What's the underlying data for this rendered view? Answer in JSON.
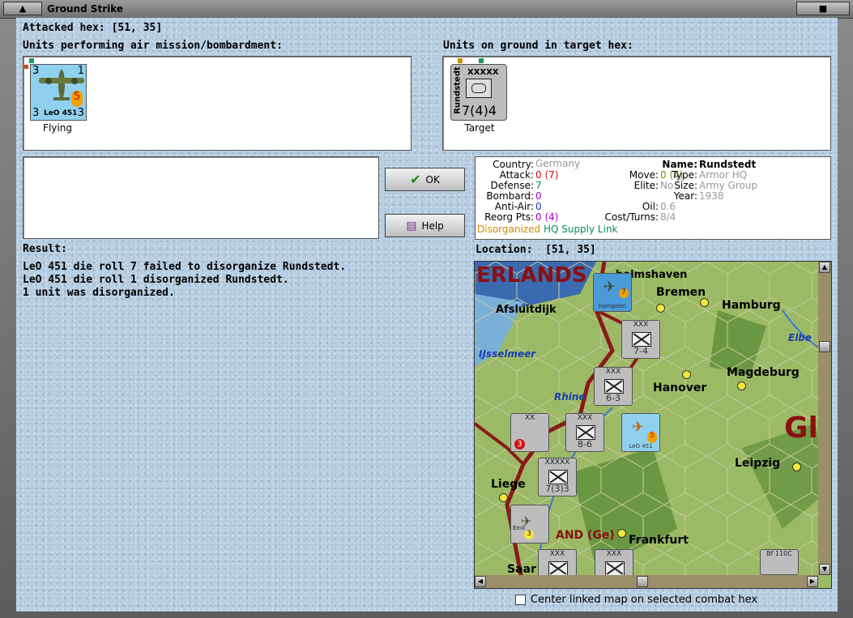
{
  "window": {
    "title": "Ground Strike"
  },
  "attacked_hex": {
    "label": "Attacked hex:",
    "value": "[51, 35]"
  },
  "air_units": {
    "label": "Units performing air mission/bombardment:",
    "unit": {
      "name": "LeO 451",
      "left_num": "3",
      "right_num": "1",
      "bottom_left": "3",
      "bottom_right": "3",
      "badge": "5",
      "caption": "Flying"
    }
  },
  "ground_units": {
    "label": "Units on ground in target hex:",
    "unit": {
      "name": "Rundstedt",
      "size": "XXXXX",
      "strength": "7(4)4",
      "caption": "Target"
    }
  },
  "buttons": {
    "ok": "OK",
    "help": "Help"
  },
  "info": {
    "country_k": "Country:",
    "country_v": "Germany",
    "attack_k": "Attack:",
    "attack_v": "0",
    "attack_v2": "(7)",
    "defense_k": "Defense:",
    "defense_v": "7",
    "bombard_k": "Bombard:",
    "bombard_v": "0",
    "antiair_k": "Anti-Air:",
    "antiair_v": "0",
    "reorg_k": "Reorg Pts:",
    "reorg_v": "0",
    "reorg_v2": "(4)",
    "name_k": "Name:",
    "name_v": "Rundstedt",
    "move_k": "Move:",
    "move_v": "0",
    "move_v2": "(4)",
    "type_k": "Type:",
    "type_v": "Armor HQ",
    "elite_k": "Elite:",
    "elite_v": "No",
    "size_k": "Size:",
    "size_v": "Army Group",
    "year_k": "Year:",
    "year_v": "1938",
    "oil_k": "Oil:",
    "oil_v": "0.6",
    "cost_k": "Cost/Turns:",
    "cost_v": "8/4",
    "status1": "Disorganized",
    "status2": "HQ Supply Link"
  },
  "result": {
    "label": "Result:",
    "lines": [
      "LeO 451 die roll 7 failed to disorganize Rundstedt.",
      "LeO 451 die roll 1 disorganized Rundstedt.",
      "1 unit was disorganized."
    ]
  },
  "location": {
    "label": "Location:",
    "value": "[51, 35]"
  },
  "map": {
    "cities": [
      "Bremen",
      "Hamburg",
      "Magdeburg",
      "Hanover",
      "Leipzig",
      "Liege",
      "Frankfurt",
      "Saar",
      "Afsluitdijk"
    ],
    "region_labels": [
      "ERLANDS",
      "AND (Ge)",
      "Gl"
    ],
    "waters": [
      "IJsselmeer",
      "Rhine",
      "Elbe"
    ],
    "top_city": "helmshaven",
    "counters": [
      {
        "size": "XXX",
        "str": "7-4"
      },
      {
        "size": "XXX",
        "str": "6-3"
      },
      {
        "size": "XXX",
        "str": "8-6"
      },
      {
        "size": "XXXXX",
        "str": "7(3)3"
      },
      {
        "size": "XX",
        "str": "3"
      },
      {
        "size": "XXX",
        "str": ""
      },
      {
        "size": "XXX",
        "str": ""
      }
    ],
    "air": [
      {
        "name": "Hampden",
        "badge": "7"
      },
      {
        "name": "LeO 451",
        "badge": "5"
      },
      {
        "name": "Emil",
        "badge": "3"
      },
      {
        "name": "Bf 110C",
        "badge": ""
      }
    ]
  },
  "checkbox": {
    "label": "Center linked map on selected combat hex",
    "checked": false
  },
  "colors": {
    "background": "#b3cbe0",
    "dark_red": "#7a1010",
    "green": "#0a8a5a",
    "orange": "#d08a00",
    "red": "#d01010",
    "purple": "#a000c0",
    "blue": "#1a3fb0"
  }
}
